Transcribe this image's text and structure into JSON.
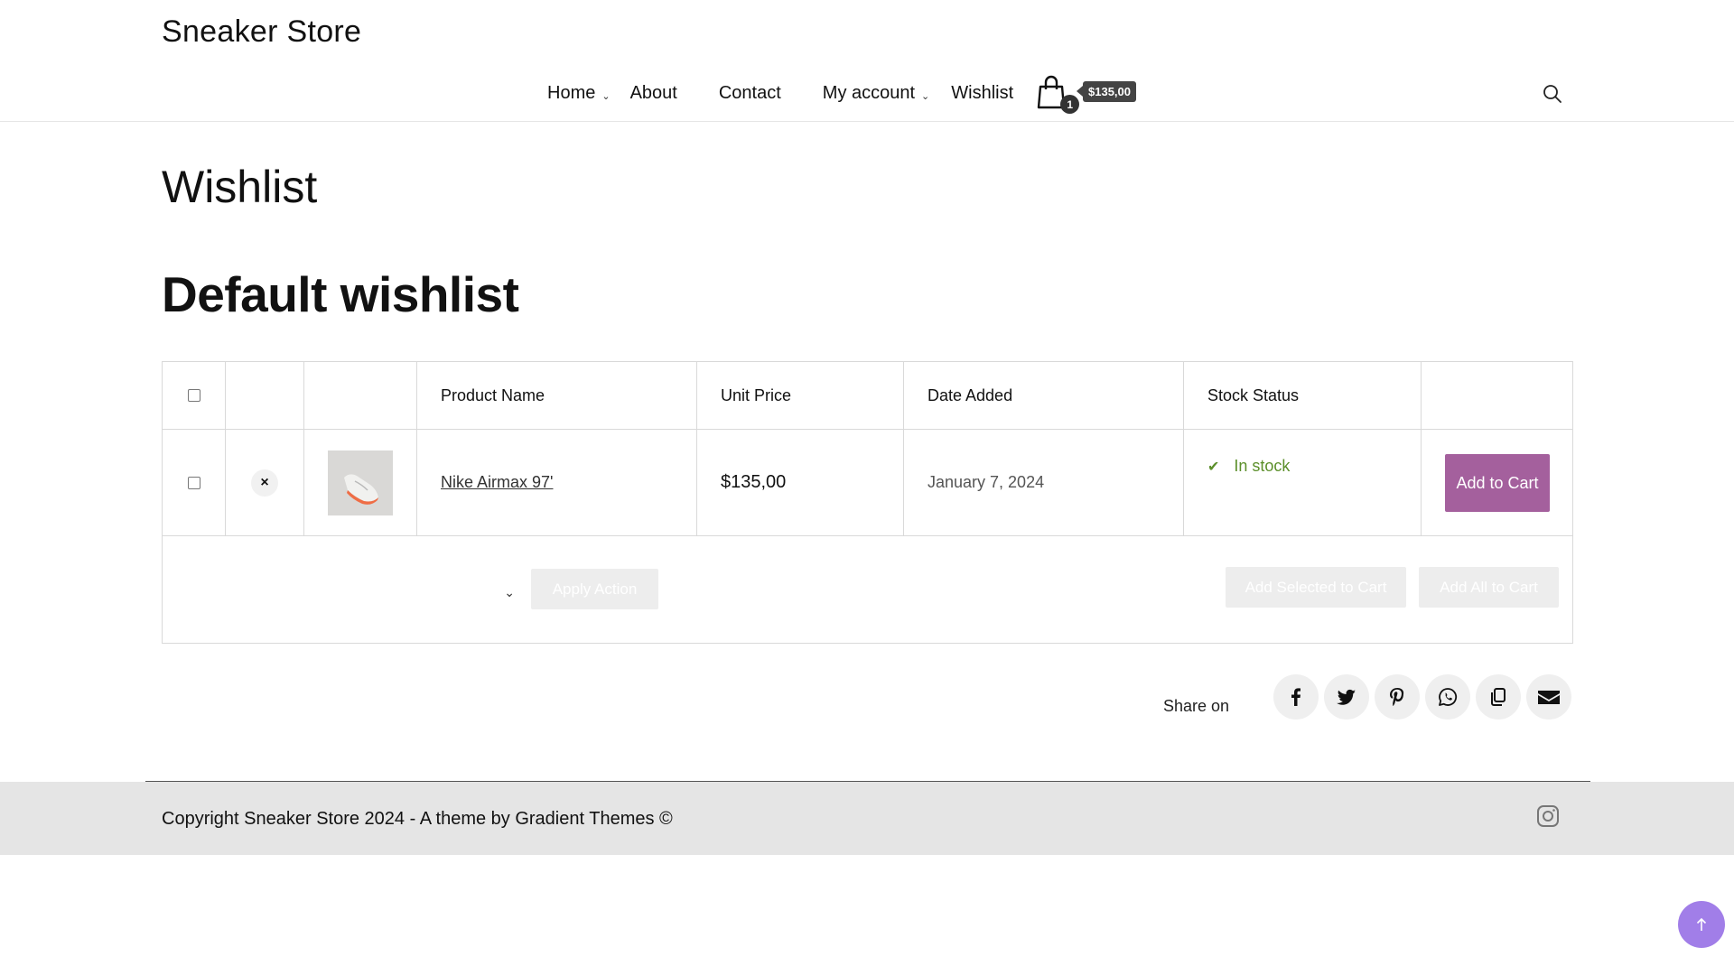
{
  "header": {
    "site_title": "Sneaker Store",
    "nav": {
      "home": "Home",
      "about": "About",
      "contact": "Contact",
      "my_account": "My account",
      "wishlist": "Wishlist"
    },
    "cart_count": "1",
    "cart_total": "$135,00"
  },
  "page": {
    "title": "Wishlist",
    "wishlist_name": "Default wishlist"
  },
  "table": {
    "headers": {
      "product_name": "Product Name",
      "unit_price": "Unit Price",
      "date_added": "Date Added",
      "stock_status": "Stock Status"
    },
    "items": [
      {
        "remove_glyph": "×",
        "product_name": "Nike Airmax 97'",
        "price": "$135,00",
        "date_added": "January 7, 2024",
        "stock_status": "In stock",
        "add_to_cart": "Add to Cart"
      }
    ],
    "actions": {
      "select_chevron": "⌄",
      "apply": "Apply Action",
      "add_selected": "Add Selected to Cart",
      "add_all": "Add All to Cart"
    }
  },
  "share": {
    "label": "Share on",
    "networks": [
      "facebook-icon",
      "twitter-icon",
      "pinterest-icon",
      "whatsapp-icon",
      "copy-icon",
      "email-icon"
    ]
  },
  "footer": {
    "copyright": "Copyright Sneaker Store 2024 - A theme by Gradient Themes ©"
  },
  "colors": {
    "accent": "#a4609d",
    "stock_green": "#5b8f2a",
    "scroll_top": "#a17ee8",
    "footer_bg": "#e5e5e5"
  }
}
